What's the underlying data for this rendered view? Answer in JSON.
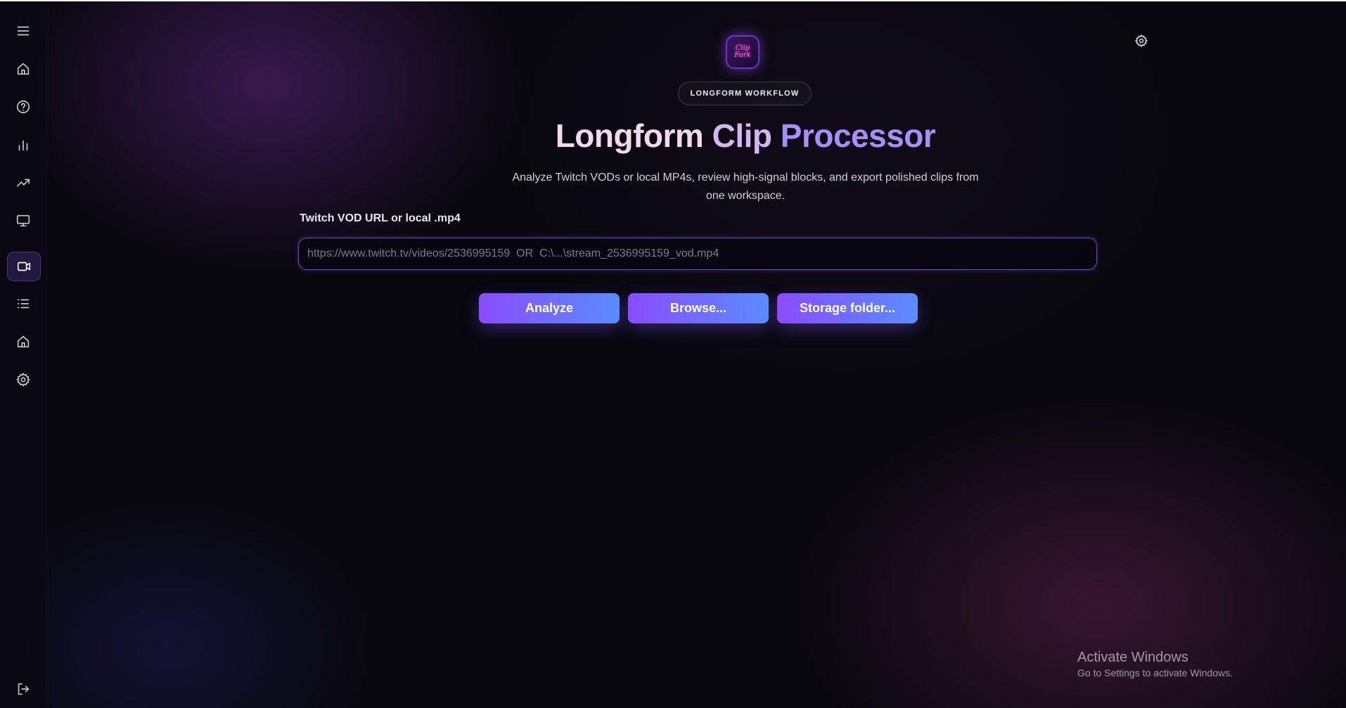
{
  "header": {
    "badge": "LONGFORM WORKFLOW",
    "title_part1": "Longform",
    "title_part2": "Clip",
    "title_part3": "Processor",
    "subtitle": "Analyze Twitch VODs or local MP4s, review high-signal blocks, and export polished clips from one workspace.",
    "logo_text": "Clip Fork"
  },
  "form": {
    "label": "Twitch VOD URL or local .mp4",
    "placeholder": "https://www.twitch.tv/videos/2536995159  OR  C:\\...\\stream_2536995159_vod.mp4",
    "value": ""
  },
  "actions": {
    "analyze": "Analyze",
    "browse": "Browse...",
    "storage": "Storage folder..."
  },
  "sidebar": {
    "icons": [
      "menu-icon",
      "home-icon",
      "help-icon",
      "bar-chart-icon",
      "trending-icon",
      "monitor-icon",
      "video-icon",
      "list-icon",
      "home-icon",
      "settings-icon",
      "logout-icon"
    ],
    "active": "video-icon"
  },
  "windows_notice": {
    "line1": "Activate Windows",
    "line2": "Go to Settings to activate Windows."
  },
  "colors": {
    "accent_start": "#8a4cff",
    "accent_end": "#5a8cff",
    "background": "#08070d"
  }
}
